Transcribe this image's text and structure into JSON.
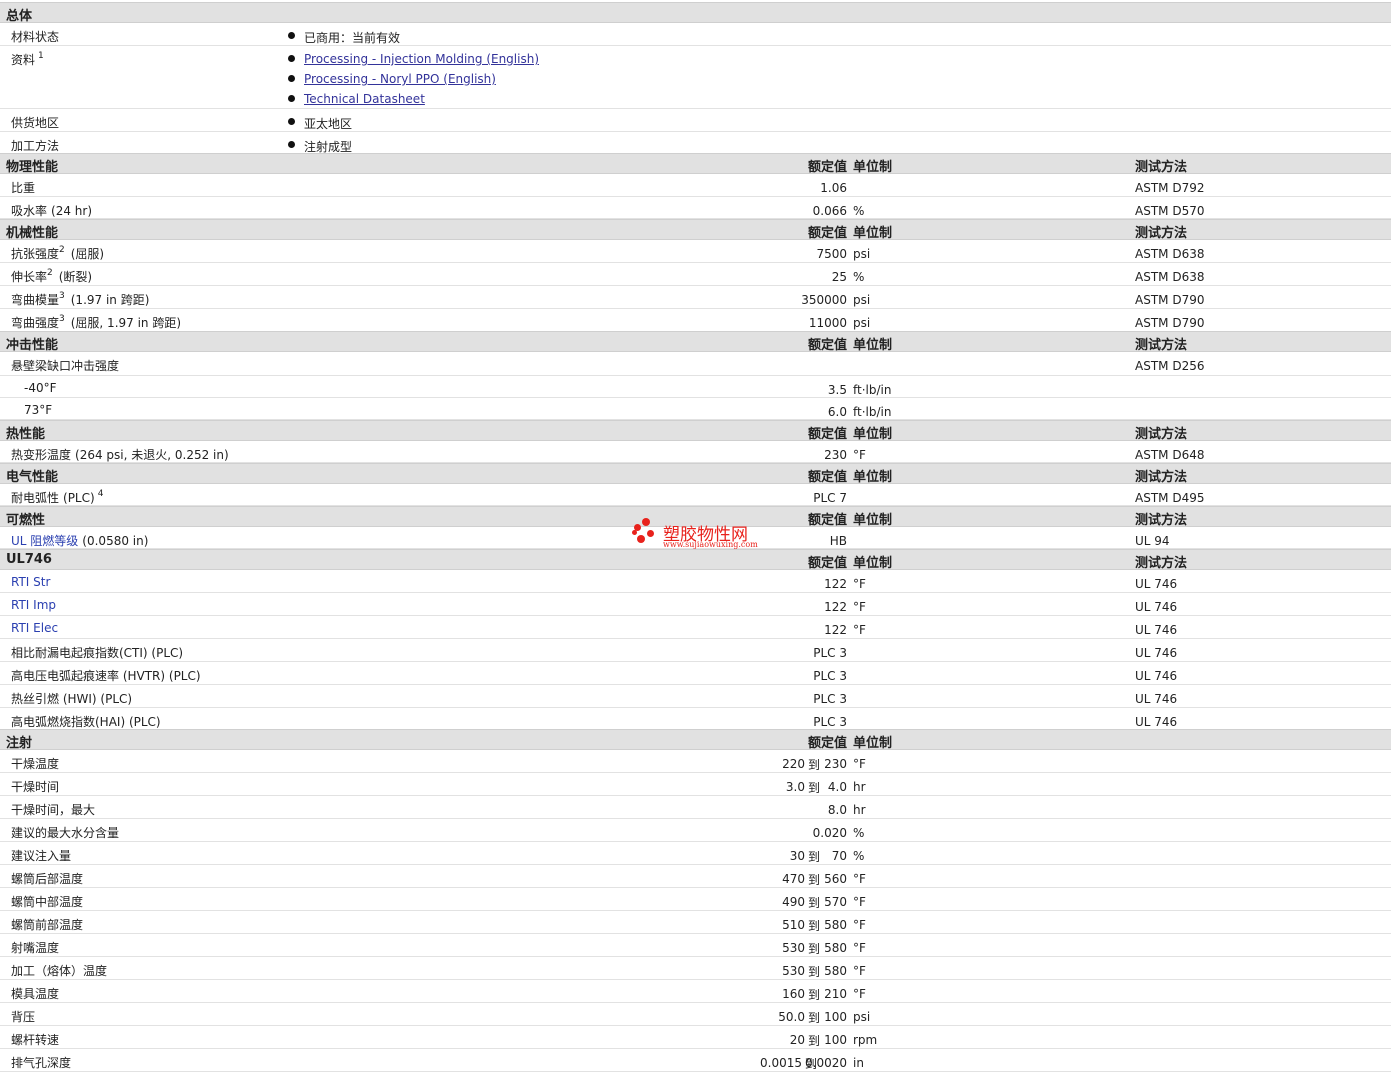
{
  "general": {
    "title": "总体",
    "rows": [
      {
        "label": "材料状态",
        "items": [
          "已商用：当前有效"
        ]
      },
      {
        "label": "资料",
        "sup": "1",
        "links": [
          "Processing - Injection Molding (English)",
          "Processing - Noryl PPO (English)",
          "Technical Datasheet"
        ]
      },
      {
        "label": "供货地区",
        "items": [
          "亚太地区"
        ]
      },
      {
        "label": "加工方法",
        "items": [
          "注射成型"
        ]
      }
    ]
  },
  "columns": {
    "nominal": "额定值",
    "unit": "单位制",
    "method": "测试方法"
  },
  "physical": {
    "title": "物理性能",
    "rows": [
      {
        "label": "比重",
        "value": "1.06",
        "unit": "",
        "method": "ASTM D792"
      },
      {
        "label": "吸水率",
        "cond": "(24 hr)",
        "value": "0.066",
        "unit": "%",
        "method": "ASTM D570"
      }
    ]
  },
  "mechanical": {
    "title": "机械性能",
    "rows": [
      {
        "label": "抗张强度",
        "sup": "2",
        "cond": "(屈服)",
        "value": "7500",
        "unit": "psi",
        "method": "ASTM D638"
      },
      {
        "label": "伸长率",
        "sup": "2",
        "cond": "(断裂)",
        "value": "25",
        "unit": "%",
        "method": "ASTM D638"
      },
      {
        "label": "弯曲模量",
        "sup": "3",
        "cond": "(1.97 in 跨距)",
        "value": "350000",
        "unit": "psi",
        "method": "ASTM D790"
      },
      {
        "label": "弯曲强度",
        "sup": "3",
        "cond": "(屈服, 1.97 in 跨距)",
        "value": "11000",
        "unit": "psi",
        "method": "ASTM D790"
      }
    ]
  },
  "impact": {
    "title": "冲击性能",
    "rows": [
      {
        "label": "悬壁梁缺口冲击强度",
        "value": "",
        "unit": "",
        "method": "ASTM D256"
      },
      {
        "label": "-40°F",
        "value": "3.5",
        "unit": "ft·lb/in",
        "method": ""
      },
      {
        "label": "73°F",
        "value": "6.0",
        "unit": "ft·lb/in",
        "method": ""
      }
    ]
  },
  "thermal": {
    "title": "热性能",
    "rows": [
      {
        "label": "热变形温度",
        "cond": "(264 psi, 未退火, 0.252 in)",
        "value": "230",
        "unit": "°F",
        "method": "ASTM D648"
      }
    ]
  },
  "electrical": {
    "title": "电气性能",
    "rows": [
      {
        "label": "耐电弧性",
        "cond": "(PLC)",
        "sup": "4",
        "value": "PLC 7",
        "unit": "",
        "method": "ASTM D495"
      }
    ]
  },
  "flammability": {
    "title": "可燃性",
    "rows": [
      {
        "label": "UL 阻燃等级",
        "cond": "(0.0580 in)",
        "value": "HB",
        "unit": "",
        "method": "UL 94"
      }
    ]
  },
  "ul746": {
    "title": "UL746",
    "rows": [
      {
        "label": "RTI Str",
        "value": "122",
        "unit": "°F",
        "method": "UL 746"
      },
      {
        "label": "RTI Imp",
        "value": "122",
        "unit": "°F",
        "method": "UL 746"
      },
      {
        "label": "RTI Elec",
        "value": "122",
        "unit": "°F",
        "method": "UL 746"
      },
      {
        "label": "相比耐漏电起痕指数(CTI) (PLC)",
        "value": "PLC 3",
        "unit": "",
        "method": "UL 746"
      },
      {
        "label": "高电压电弧起痕速率 (HVTR) (PLC)",
        "value": "PLC 3",
        "unit": "",
        "method": "UL 746"
      },
      {
        "label": "热丝引燃 (HWI) (PLC)",
        "value": "PLC 3",
        "unit": "",
        "method": "UL 746"
      },
      {
        "label": "高电弧燃烧指数(HAI) (PLC)",
        "value": "PLC 3",
        "unit": "",
        "method": "UL 746"
      }
    ]
  },
  "injection": {
    "title": "注射",
    "to": "到",
    "rows": [
      {
        "label": "干燥温度",
        "min": "220",
        "max": "230",
        "unit": "°F"
      },
      {
        "label": "干燥时间",
        "min": "3.0",
        "max": "4.0",
        "unit": "hr"
      },
      {
        "label": "干燥时间，最大",
        "min": "",
        "max": "8.0",
        "unit": "hr"
      },
      {
        "label": "建议的最大水分含量",
        "min": "",
        "max": "0.020",
        "unit": "%"
      },
      {
        "label": "建议注入量",
        "min": "30",
        "max": "70",
        "unit": "%"
      },
      {
        "label": "螺筒后部温度",
        "min": "470",
        "max": "560",
        "unit": "°F"
      },
      {
        "label": "螺筒中部温度",
        "min": "490",
        "max": "570",
        "unit": "°F"
      },
      {
        "label": "螺筒前部温度",
        "min": "510",
        "max": "580",
        "unit": "°F"
      },
      {
        "label": "射嘴温度",
        "min": "530",
        "max": "580",
        "unit": "°F"
      },
      {
        "label": "加工（熔体）温度",
        "min": "530",
        "max": "580",
        "unit": "°F"
      },
      {
        "label": "模具温度",
        "min": "160",
        "max": "210",
        "unit": "°F"
      },
      {
        "label": "背压",
        "min": "50.0",
        "max": "100",
        "unit": "psi"
      },
      {
        "label": "螺杆转速",
        "min": "20",
        "max": "100",
        "unit": "rpm"
      },
      {
        "label": "排气孔深度",
        "min": "0.0015",
        "max": "0.0020",
        "unit": "in"
      }
    ]
  },
  "watermark": {
    "cn": "塑胶物性网",
    "en": "www.sujiaowuxing.com",
    "color": "#e8221c"
  }
}
